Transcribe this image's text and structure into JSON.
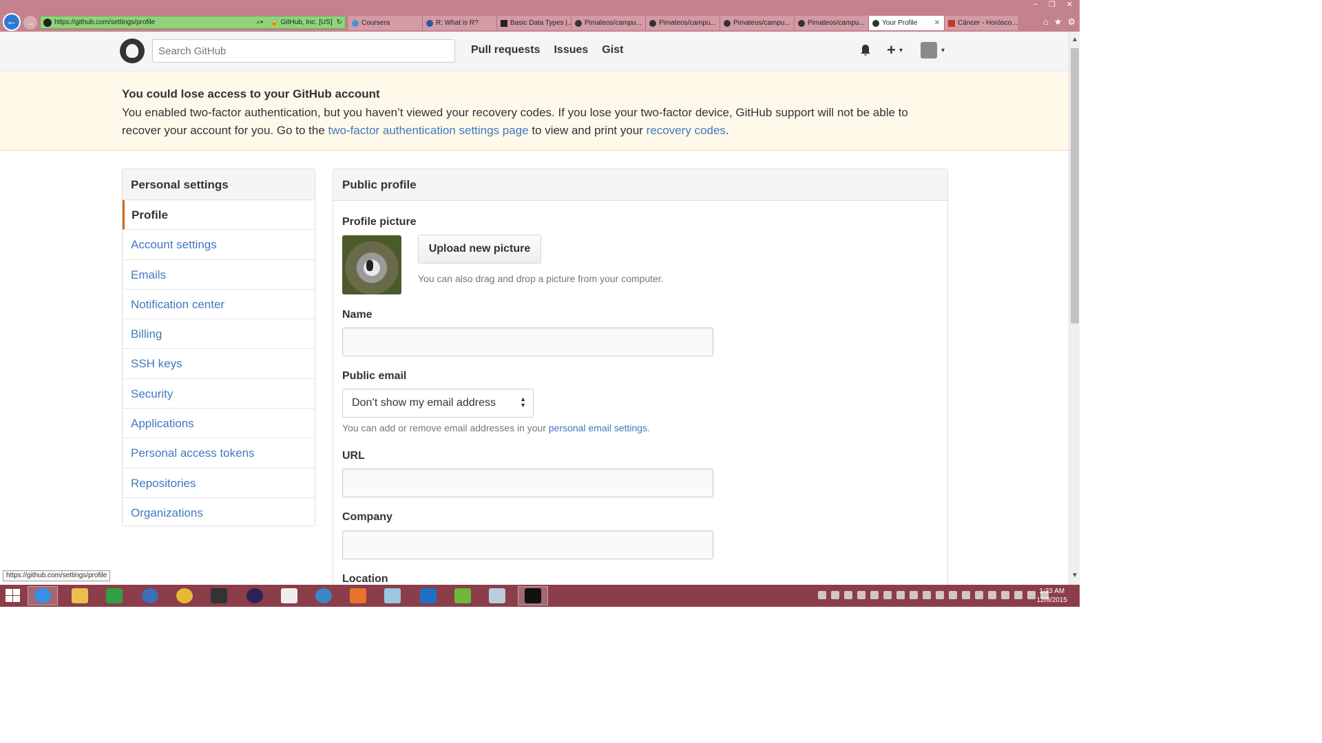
{
  "browser": {
    "url": "https://github.com/settings/profile",
    "cert": "GitHub, Inc. [US]",
    "tabs": [
      {
        "label": "Coursera"
      },
      {
        "label": "R: What is R?"
      },
      {
        "label": "Basic Data Types |..."
      },
      {
        "label": "Pimateos/campu..."
      },
      {
        "label": "Pimateos/campu..."
      },
      {
        "label": "Pimateos/campu..."
      },
      {
        "label": "Pimateos/campu..."
      },
      {
        "label": "Your Profile"
      },
      {
        "label": "Cáncer - Horósco..."
      }
    ],
    "status_url": "https://github.com/settings/profile"
  },
  "header": {
    "search_placeholder": "Search GitHub",
    "nav": [
      "Pull requests",
      "Issues",
      "Gist"
    ],
    "plus": "+",
    "caret": "▾"
  },
  "flash": {
    "title": "You could lose access to your GitHub account",
    "body_1": "You enabled two-factor authentication, but you haven’t viewed your recovery codes. If you lose your two-factor device, GitHub support will not be able to recover your account for you. Go to the ",
    "link_1": "two-factor authentication settings page",
    "body_2": " to view and print your ",
    "link_2": "recovery codes",
    "body_3": "."
  },
  "sidebar": {
    "title": "Personal settings",
    "items": [
      {
        "label": "Profile"
      },
      {
        "label": "Account settings"
      },
      {
        "label": "Emails"
      },
      {
        "label": "Notification center"
      },
      {
        "label": "Billing"
      },
      {
        "label": "SSH keys"
      },
      {
        "label": "Security"
      },
      {
        "label": "Applications"
      },
      {
        "label": "Personal access tokens"
      },
      {
        "label": "Repositories"
      },
      {
        "label": "Organizations"
      }
    ]
  },
  "main": {
    "title": "Public profile",
    "picture_label": "Profile picture",
    "upload_label": "Upload new picture",
    "drag_note": "You can also drag and drop a picture from your computer.",
    "name_label": "Name",
    "name_value": "",
    "public_email_label": "Public email",
    "public_email_value": "Don’t show my email address",
    "email_note_1": "You can add or remove email addresses in your ",
    "email_note_link": "personal email settings",
    "email_note_2": ".",
    "url_label": "URL",
    "url_value": "",
    "company_label": "Company",
    "company_value": "",
    "location_label": "Location"
  },
  "clock": {
    "time": "1:33 AM",
    "date": "12/8/2015"
  },
  "colors": {
    "accent": "#4078c0",
    "ie_frame": "#c4828e",
    "taskbar": "#8c3d4a",
    "flash_bg": "#fff9ea",
    "selected_border": "#d26911"
  },
  "icons": [
    "github-logo-icon",
    "bell-icon",
    "plus-icon",
    "avatar-icon",
    "back-arrow-icon",
    "forward-arrow-icon",
    "lock-icon",
    "refresh-icon",
    "home-icon",
    "star-icon",
    "gear-icon",
    "windows-start-icon"
  ]
}
